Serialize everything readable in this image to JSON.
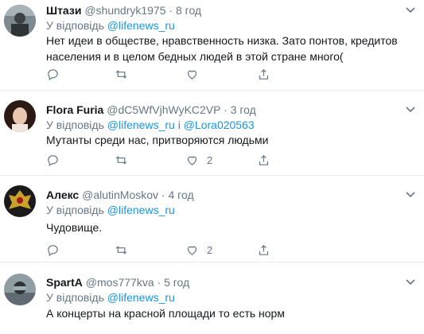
{
  "reply_prefix": "У відповідь",
  "and_word": "і",
  "tweets": [
    {
      "name": "Штази",
      "handle": "@shundryk1975",
      "time": "8 год",
      "reply_to": [
        "@lifenews_ru"
      ],
      "text": "Нет идеи в обществе, нравственность низка. Зато понтов, кредитов населения и в целом бедных людей в этой стране много(",
      "likes": ""
    },
    {
      "name": "Flora Furia",
      "handle": "@dC5WfVjhWyKC2VP",
      "time": "3 год",
      "reply_to": [
        "@lifenews_ru",
        "@Lora020563"
      ],
      "text": "Мутанты среди нас, притворяются людьми",
      "likes": "2"
    },
    {
      "name": "Алекс",
      "handle": "@alutinMoskov",
      "time": "4 год",
      "reply_to": [
        "@lifenews_ru"
      ],
      "text": "Чудовище.",
      "likes": "2"
    },
    {
      "name": "SpartA",
      "handle": "@mos777kva",
      "time": "5 год",
      "reply_to": [
        "@lifenews_ru"
      ],
      "text": "А концерты на красной площади то есть норм",
      "likes": ""
    }
  ],
  "colors": {
    "link": "#1b95e0",
    "muted": "#657786",
    "divider": "#e6ecf0"
  }
}
